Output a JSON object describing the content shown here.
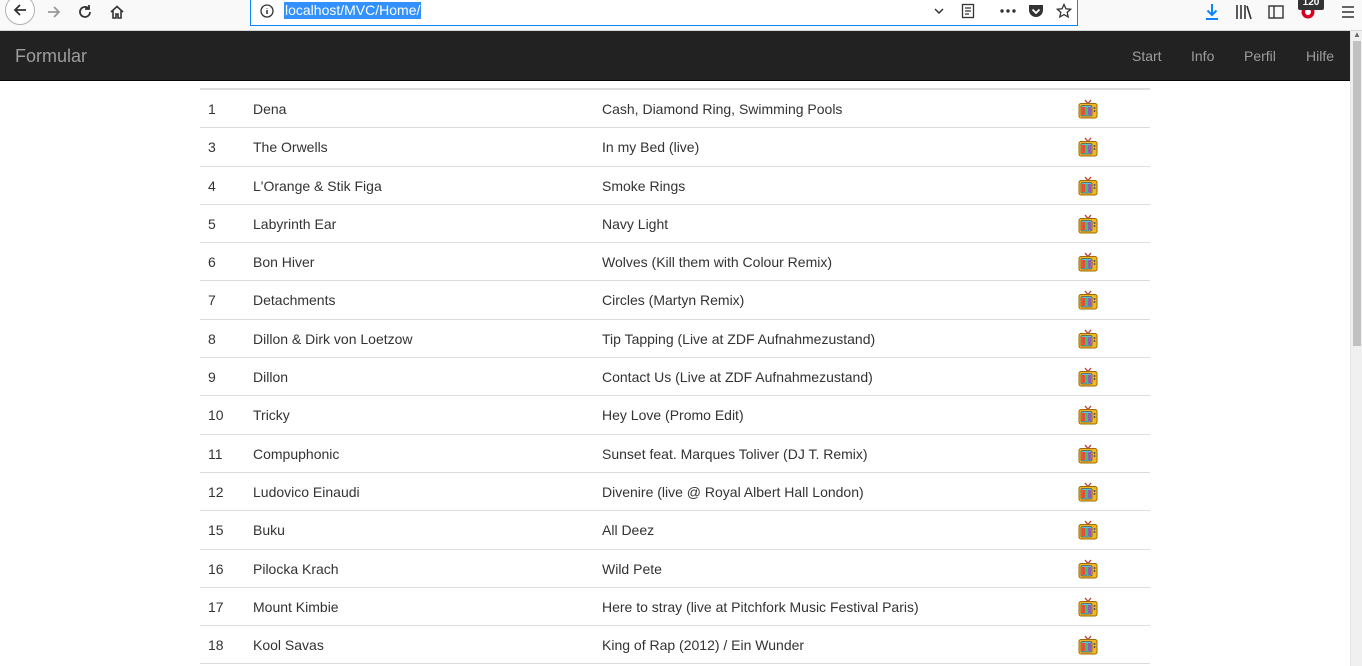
{
  "browser": {
    "url": "localhost/MVC/Home/",
    "notification_count": "120"
  },
  "navbar": {
    "brand": "Formular",
    "items": [
      "Start",
      "Info",
      "Perfil",
      "Hilfe"
    ]
  },
  "table": {
    "rows": [
      {
        "num": "1",
        "artist": "Dena",
        "title": "Cash, Diamond Ring, Swimming Pools",
        "icon": "tv-icon"
      },
      {
        "num": "3",
        "artist": "The Orwells",
        "title": "In my Bed (live)",
        "icon": "tv-icon"
      },
      {
        "num": "4",
        "artist": "L'Orange & Stik Figa",
        "title": "Smoke Rings",
        "icon": "tv-icon"
      },
      {
        "num": "5",
        "artist": "Labyrinth Ear",
        "title": "Navy Light",
        "icon": "tv-icon"
      },
      {
        "num": "6",
        "artist": "Bon Hiver",
        "title": "Wolves (Kill them with Colour Remix)",
        "icon": "tv-icon"
      },
      {
        "num": "7",
        "artist": "Detachments",
        "title": "Circles (Martyn Remix)",
        "icon": "tv-icon"
      },
      {
        "num": "8",
        "artist": "Dillon & Dirk von Loetzow",
        "title": "Tip Tapping (Live at ZDF Aufnahmezustand)",
        "icon": "tv-icon"
      },
      {
        "num": "9",
        "artist": "Dillon",
        "title": "Contact Us (Live at ZDF Aufnahmezustand)",
        "icon": "tv-icon"
      },
      {
        "num": "10",
        "artist": "Tricky",
        "title": "Hey Love (Promo Edit)",
        "icon": "tv-icon"
      },
      {
        "num": "11",
        "artist": "Compuphonic",
        "title": "Sunset feat. Marques Toliver (DJ T. Remix)",
        "icon": "tv-icon"
      },
      {
        "num": "12",
        "artist": "Ludovico Einaudi",
        "title": "Divenire (live @ Royal Albert Hall London)",
        "icon": "tv-icon"
      },
      {
        "num": "15",
        "artist": "Buku",
        "title": "All Deez",
        "icon": "tv-icon"
      },
      {
        "num": "16",
        "artist": "Pilocka Krach",
        "title": "Wild Pete",
        "icon": "tv-icon"
      },
      {
        "num": "17",
        "artist": "Mount Kimbie",
        "title": "Here to stray (live at Pitchfork Music Festival Paris)",
        "icon": "tv-icon"
      },
      {
        "num": "18",
        "artist": "Kool Savas",
        "title": "King of Rap (2012) / Ein Wunder",
        "icon": "tv-icon"
      }
    ]
  }
}
